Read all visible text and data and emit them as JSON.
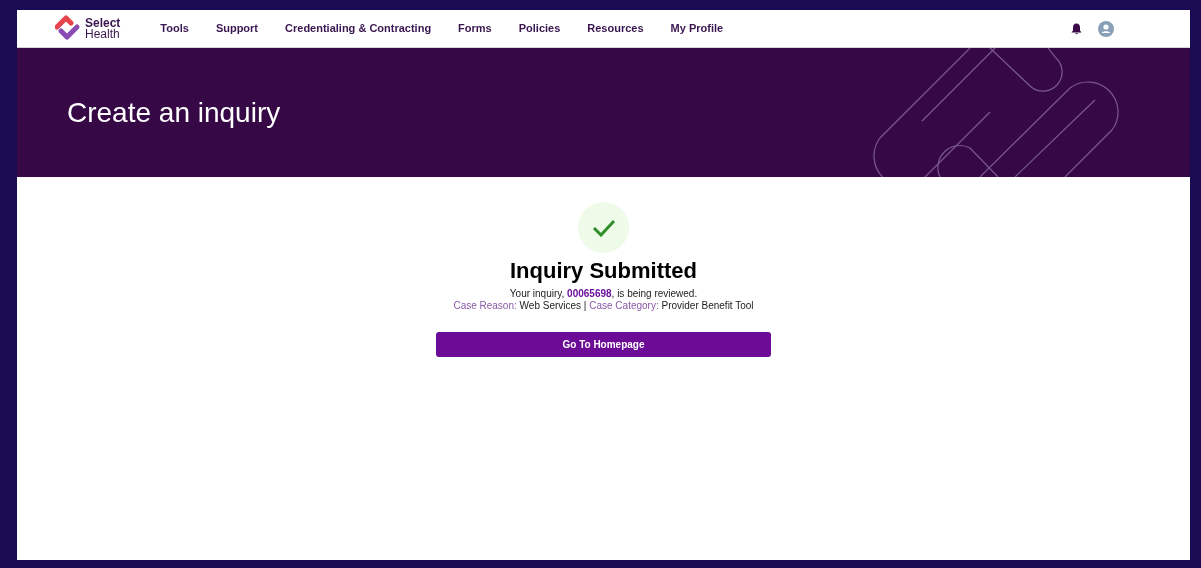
{
  "logo": {
    "line1": "Select",
    "line2": "Health"
  },
  "nav": [
    {
      "label": "Tools"
    },
    {
      "label": "Support"
    },
    {
      "label": "Credentialing & Contracting"
    },
    {
      "label": "Forms"
    },
    {
      "label": "Policies"
    },
    {
      "label": "Resources"
    },
    {
      "label": "My Profile"
    }
  ],
  "banner": {
    "title": "Create an inquiry"
  },
  "confirmation": {
    "heading": "Inquiry Submitted",
    "message_before": "Your inquiry, ",
    "case_number": "00065698",
    "message_after": ", is being reviewed.",
    "details": [
      {
        "label": "Case Reason:",
        "value": "Web Services"
      },
      {
        "label": "Case Category:",
        "value": "Provider Benefit Tool"
      }
    ],
    "separator": "|",
    "button": "Go To Homepage"
  }
}
